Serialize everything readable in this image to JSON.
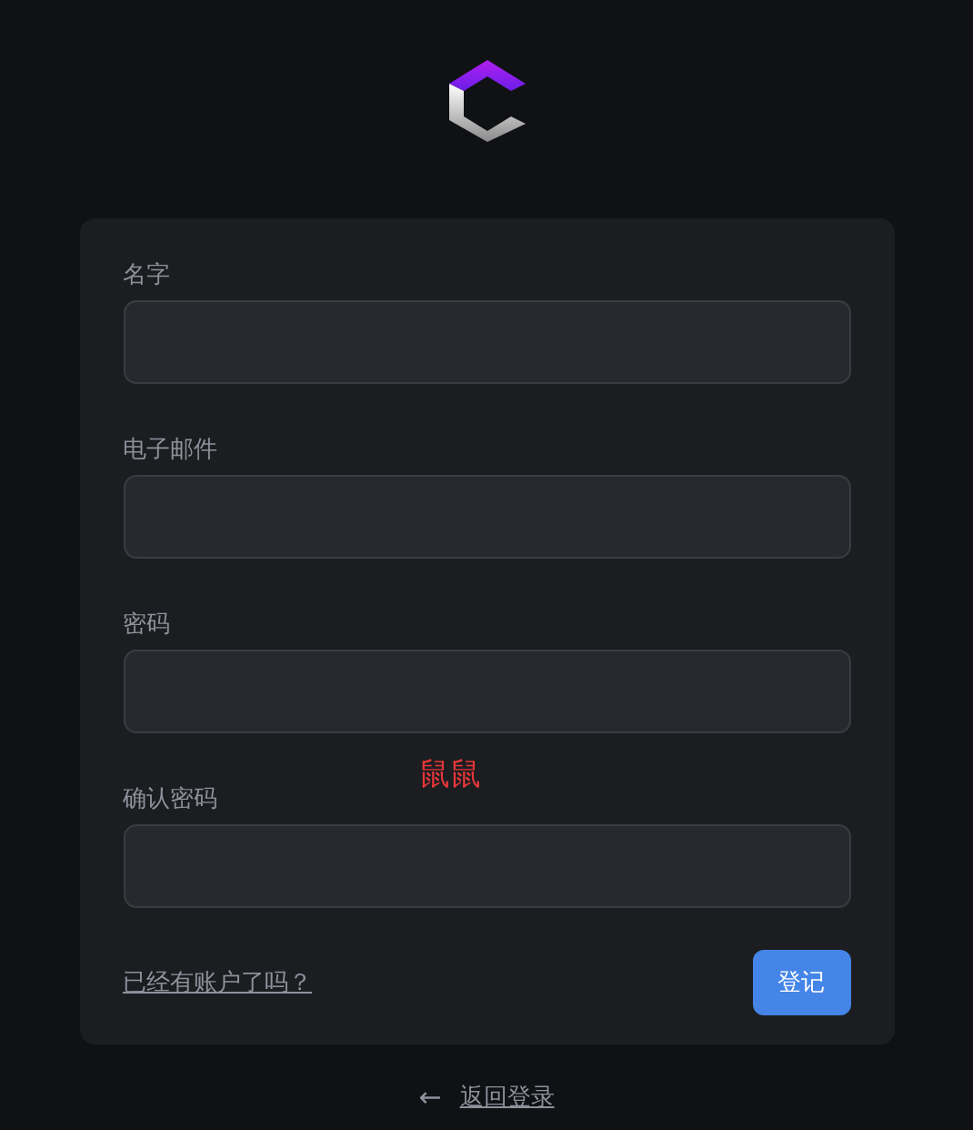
{
  "form": {
    "fields": [
      {
        "label": "名字"
      },
      {
        "label": "电子邮件"
      },
      {
        "label": "密码"
      },
      {
        "label": "确认密码"
      }
    ],
    "annotation": "鼠鼠",
    "login_link": "已经有账户了吗？",
    "submit_button": "登记"
  },
  "back_link": {
    "icon": "←",
    "label": "返回登录"
  }
}
